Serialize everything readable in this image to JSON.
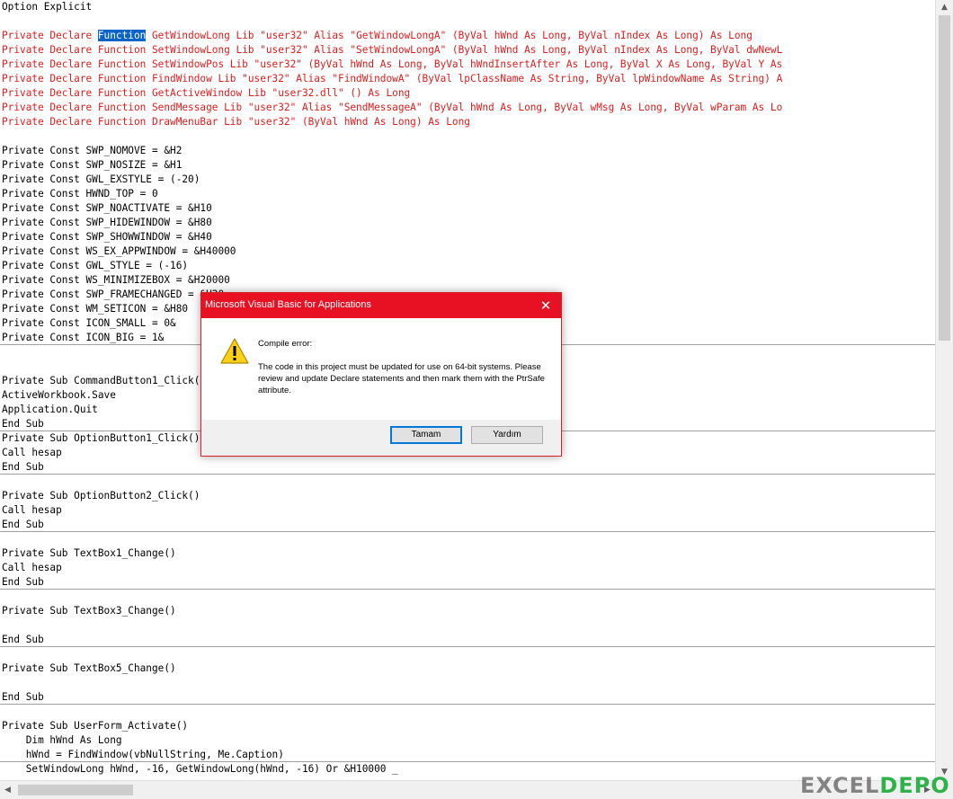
{
  "code_lines": [
    {
      "text": "Option Explicit",
      "red": false
    },
    {
      "text": "",
      "red": false
    },
    {
      "text": "Private Declare ",
      "red": true,
      "highlight": "Function",
      "rest": " GetWindowLong Lib \"user32\" Alias \"GetWindowLongA\" (ByVal hWnd As Long, ByVal nIndex As Long) As Long"
    },
    {
      "text": "Private Declare Function SetWindowLong Lib \"user32\" Alias \"SetWindowLongA\" (ByVal hWnd As Long, ByVal nIndex As Long, ByVal dwNewL",
      "red": true
    },
    {
      "text": "Private Declare Function SetWindowPos Lib \"user32\" (ByVal hWnd As Long, ByVal hWndInsertAfter As Long, ByVal X As Long, ByVal Y As",
      "red": true
    },
    {
      "text": "Private Declare Function FindWindow Lib \"user32\" Alias \"FindWindowA\" (ByVal lpClassName As String, ByVal lpWindowName As String) A",
      "red": true
    },
    {
      "text": "Private Declare Function GetActiveWindow Lib \"user32.dll\" () As Long",
      "red": true
    },
    {
      "text": "Private Declare Function SendMessage Lib \"user32\" Alias \"SendMessageA\" (ByVal hWnd As Long, ByVal wMsg As Long, ByVal wParam As Lo",
      "red": true
    },
    {
      "text": "Private Declare Function DrawMenuBar Lib \"user32\" (ByVal hWnd As Long) As Long",
      "red": true
    },
    {
      "text": "",
      "red": false
    },
    {
      "text": "Private Const SWP_NOMOVE = &H2",
      "red": false
    },
    {
      "text": "Private Const SWP_NOSIZE = &H1",
      "red": false
    },
    {
      "text": "Private Const GWL_EXSTYLE = (-20)",
      "red": false
    },
    {
      "text": "Private Const HWND_TOP = 0",
      "red": false
    },
    {
      "text": "Private Const SWP_NOACTIVATE = &H10",
      "red": false
    },
    {
      "text": "Private Const SWP_HIDEWINDOW = &H80",
      "red": false
    },
    {
      "text": "Private Const SWP_SHOWWINDOW = &H40",
      "red": false
    },
    {
      "text": "Private Const WS_EX_APPWINDOW = &H40000",
      "red": false
    },
    {
      "text": "Private Const GWL_STYLE = (-16)",
      "red": false
    },
    {
      "text": "Private Const WS_MINIMIZEBOX = &H20000",
      "red": false
    },
    {
      "text": "Private Const SWP_FRAMECHANGED = &H20",
      "red": false
    },
    {
      "text": "Private Const WM_SETICON = &H80",
      "red": false
    },
    {
      "text": "Private Const ICON_SMALL = 0&",
      "red": false
    },
    {
      "text": "Private Const ICON_BIG = 1&",
      "red": false
    },
    {
      "text": "",
      "red": false
    },
    {
      "text": "",
      "red": false
    },
    {
      "text": "Private Sub CommandButton1_Click()",
      "red": false
    },
    {
      "text": "ActiveWorkbook.Save",
      "red": false
    },
    {
      "text": "Application.Quit",
      "red": false
    },
    {
      "text": "End Sub",
      "red": false
    },
    {
      "text": "Private Sub OptionButton1_Click()",
      "red": false
    },
    {
      "text": "Call hesap",
      "red": false
    },
    {
      "text": "End Sub",
      "red": false
    },
    {
      "text": "",
      "red": false
    },
    {
      "text": "Private Sub OptionButton2_Click()",
      "red": false
    },
    {
      "text": "Call hesap",
      "red": false
    },
    {
      "text": "End Sub",
      "red": false
    },
    {
      "text": "",
      "red": false
    },
    {
      "text": "Private Sub TextBox1_Change()",
      "red": false
    },
    {
      "text": "Call hesap",
      "red": false
    },
    {
      "text": "End Sub",
      "red": false
    },
    {
      "text": "",
      "red": false
    },
    {
      "text": "Private Sub TextBox3_Change()",
      "red": false
    },
    {
      "text": "",
      "red": false
    },
    {
      "text": "End Sub",
      "red": false
    },
    {
      "text": "",
      "red": false
    },
    {
      "text": "Private Sub TextBox5_Change()",
      "red": false
    },
    {
      "text": "",
      "red": false
    },
    {
      "text": "End Sub",
      "red": false
    },
    {
      "text": "",
      "red": false
    },
    {
      "text": "Private Sub UserForm_Activate()",
      "red": false
    },
    {
      "text": "    Dim hWnd As Long",
      "red": false
    },
    {
      "text": "    hWnd = FindWindow(vbNullString, Me.Caption)",
      "red": false
    },
    {
      "text": "    SetWindowLong hWnd, -16, GetWindowLong(hWnd, -16) Or &H10000 _",
      "red": false
    }
  ],
  "separator_after_lines": [
    23,
    29,
    32,
    36,
    40,
    44,
    48,
    52
  ],
  "dialog": {
    "title": "Microsoft Visual Basic for Applications",
    "close_glyph": "✕",
    "heading": "Compile error:",
    "message": "The code in this project must be updated for use on 64-bit systems.  Please review and update Declare statements and then mark them with the PtrSafe attribute.",
    "ok_label": "Tamam",
    "help_label": "Yardım",
    "icon": "warning-icon"
  },
  "watermark": {
    "left": "EXCEL",
    "right": "DEPO"
  },
  "colors": {
    "code_red": "#e01b1b",
    "selection": "#0a64c8",
    "dialog_title": "#e81123",
    "primary_border": "#0078d7"
  },
  "scrollbars": {
    "up": "▲",
    "down": "▼",
    "left": "◀",
    "right": "▶"
  }
}
